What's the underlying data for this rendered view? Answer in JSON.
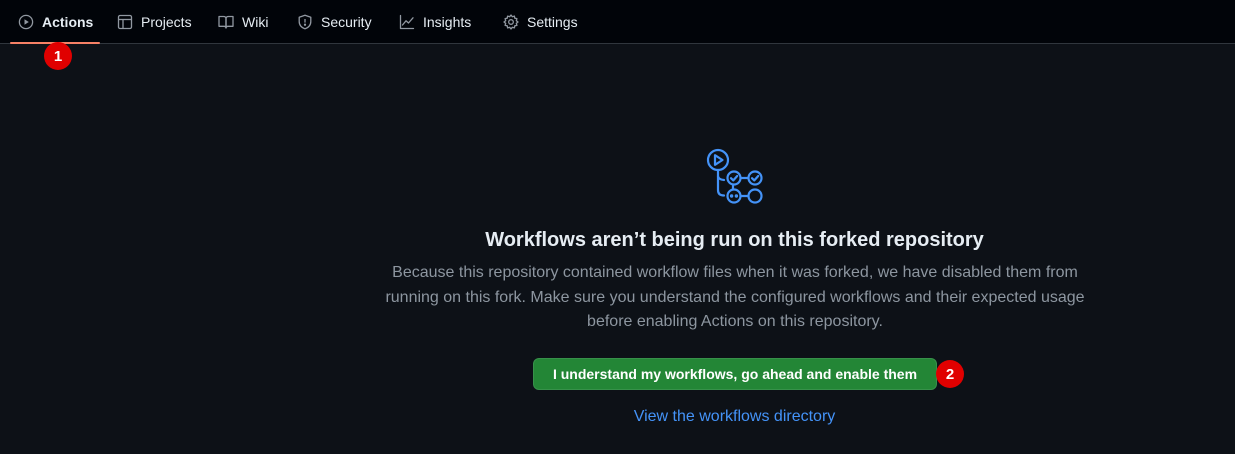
{
  "nav": {
    "tabs": [
      {
        "label": "Actions",
        "icon": "play-circle-icon",
        "active": true
      },
      {
        "label": "Projects",
        "icon": "table-icon"
      },
      {
        "label": "Wiki",
        "icon": "book-icon"
      },
      {
        "label": "Security",
        "icon": "shield-icon"
      },
      {
        "label": "Insights",
        "icon": "graph-icon"
      },
      {
        "label": "Settings",
        "icon": "gear-icon"
      }
    ],
    "active_underline_color": "#f78166"
  },
  "annotations": {
    "step1": "1",
    "step2": "2",
    "color": "#e00000"
  },
  "main": {
    "icon": "workflow-icon",
    "title": "Workflows aren’t being run on this forked repository",
    "description": "Because this repository contained workflow files when it was forked, we have disabled them from running on this fork. Make sure you understand the configured workflows and their expected usage before enabling Actions on this repository.",
    "enable_button": "I understand my workflows, go ahead and enable them",
    "directory_link": "View the workflows directory"
  },
  "colors": {
    "background": "#0d1117",
    "nav_background": "#010409",
    "button_green": "#238636",
    "link_blue": "#4493f8",
    "icon_blue": "#4493f8"
  }
}
